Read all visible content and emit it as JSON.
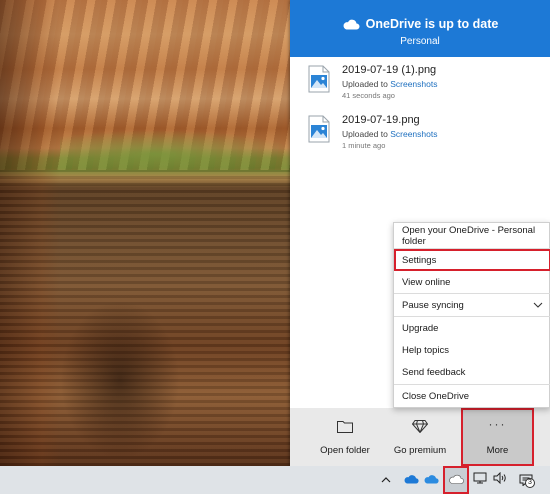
{
  "onedrive": {
    "title": "OneDrive is up to date",
    "subtitle": "Personal",
    "files": [
      {
        "name": "2019-07-19 (1).png",
        "status_prefix": "Uploaded to",
        "status_link": "Screenshots",
        "time": "41 seconds ago"
      },
      {
        "name": "2019-07-19.png",
        "status_prefix": "Uploaded to",
        "status_link": "Screenshots",
        "time": "1 minute ago"
      }
    ],
    "menu": {
      "items": [
        "Open your OneDrive - Personal folder",
        "Settings",
        "View online",
        "Pause syncing",
        "Upgrade",
        "Help topics",
        "Send feedback",
        "Close OneDrive"
      ]
    },
    "footer": {
      "open_folder": "Open folder",
      "go_premium": "Go premium",
      "more": "More",
      "more_icon": "···"
    }
  },
  "taskbar": {
    "notification_count": "3"
  },
  "colors": {
    "header_blue": "#1d79d6",
    "highlight_red": "#d6202c",
    "link_blue": "#1d6fbf"
  },
  "icons": [
    "cloud-icon",
    "image-file-icon",
    "chevron-down-icon",
    "folder-icon",
    "diamond-icon",
    "more-icon",
    "chevron-up-icon",
    "onedrive-tray-icon",
    "network-icon",
    "volume-icon",
    "action-center-icon"
  ]
}
